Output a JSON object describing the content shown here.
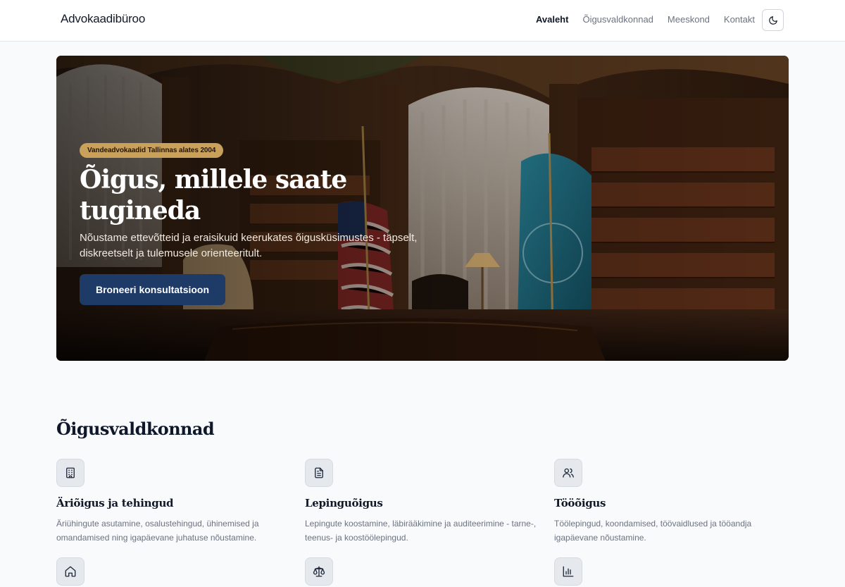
{
  "header": {
    "brand": "Advokaadibüroo",
    "nav": [
      {
        "label": "Avaleht",
        "active": true
      },
      {
        "label": "Õigusvaldkonnad",
        "active": false
      },
      {
        "label": "Meeskond",
        "active": false
      },
      {
        "label": "Kontakt",
        "active": false
      }
    ],
    "theme_toggle_icon": "moon-icon"
  },
  "hero": {
    "badge": "Vandeadvokaadid Tallinnas alates 2004",
    "title": "Õigus, millele saate tugineda",
    "subtitle": "Nõustame ettevõtteid ja eraisikuid keerukates õigusküsimustes - täpselt, diskreetselt ja tulemusele orienteeritult.",
    "cta_label": "Broneeri konsultatsioon"
  },
  "practice": {
    "title": "Õigusvaldkonnad",
    "areas": [
      {
        "icon": "building-icon",
        "title": "Äriõigus ja tehingud",
        "desc": "Äriühingute asutamine, osalustehingud, ühinemised ja omandamised ning igapäevane juhatuse nõustamine."
      },
      {
        "icon": "document-icon",
        "title": "Lepinguõigus",
        "desc": "Lepingute koostamine, läbirääkimine ja auditeerimine - tarne-, teenus- ja koostöölepingud."
      },
      {
        "icon": "users-icon",
        "title": "Tööõigus",
        "desc": "Töölepingud, koondamised, töövaidlused ja tööandja igapäevane nõustamine."
      },
      {
        "icon": "home-icon",
        "title": "",
        "desc": ""
      },
      {
        "icon": "scale-icon",
        "title": "",
        "desc": ""
      },
      {
        "icon": "bar-chart-icon",
        "title": "",
        "desc": ""
      }
    ]
  },
  "colors": {
    "accent_navy": "#1e3a66",
    "badge_gold": "#c9a15b",
    "page_bg": "#f8fafc"
  }
}
